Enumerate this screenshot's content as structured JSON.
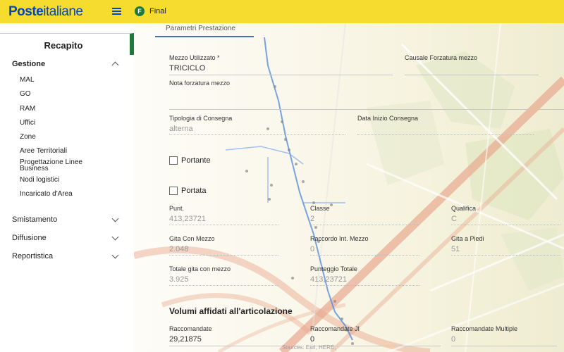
{
  "header": {
    "logo_part1": "Poste",
    "logo_part2": "italiane",
    "phase_badge": "F",
    "phase_label": "Final"
  },
  "sidebar": {
    "title": "Recapito",
    "gestione": {
      "label": "Gestione",
      "items": [
        "MAL",
        "GO",
        "RAM",
        "Uffici",
        "Zone",
        "Aree Territoriali",
        "Progettazione Linee",
        "Business",
        "Nodi logistici",
        "Incaricato d'Area"
      ]
    },
    "sections": [
      "Smistamento",
      "Diffusione",
      "Reportistica"
    ]
  },
  "main": {
    "tab": "Parametri Prestazione",
    "mezzo_label": "Mezzo Utilizzato *",
    "mezzo_value": "TRICICLO",
    "causale_label": "Causale Forzatura mezzo",
    "nota_label": "Nota forzatura mezzo",
    "tipologia_label": "Tipologia di Consegna",
    "tipologia_value": "alterna",
    "data_inizio_label": "Data Inizio Consegna",
    "portante_label": "Portante",
    "portata_label": "Portata",
    "punt_label": "Punt.",
    "punt_value": "413,23721",
    "classe_label": "Classe",
    "classe_value": "2",
    "qualifica_label": "Qualifica",
    "qualifica_value": "C",
    "gita_mezzo_label": "Gita Con Mezzo",
    "gita_mezzo_value": "2.048",
    "raccordo_label": "Raccordo Int. Mezzo",
    "raccordo_value": "0",
    "gita_piedi_label": "Gita a Piedi",
    "gita_piedi_value": "51",
    "totale_label": "Totale gita con mezzo",
    "totale_value": "3.925",
    "punteggio_label": "Punteggio Totale",
    "punteggio_value": "413,23721",
    "volumi_heading": "Volumi affidati all'articolazione",
    "raccomandate_label": "Raccomandate",
    "raccomandate_value": "29,21875",
    "raccomandate_ji_label": "Raccomandate JI",
    "raccomandate_ji_value": "0",
    "raccomandate_multiple_label": "Raccomandate Multiple",
    "raccomandate_multiple_value": "0",
    "attribution": "Sources: Esri, HERE,"
  },
  "colors": {
    "header_bg": "#f5dc2e",
    "brand_blue": "#0047bb",
    "accent_green": "#1e7a3b"
  }
}
